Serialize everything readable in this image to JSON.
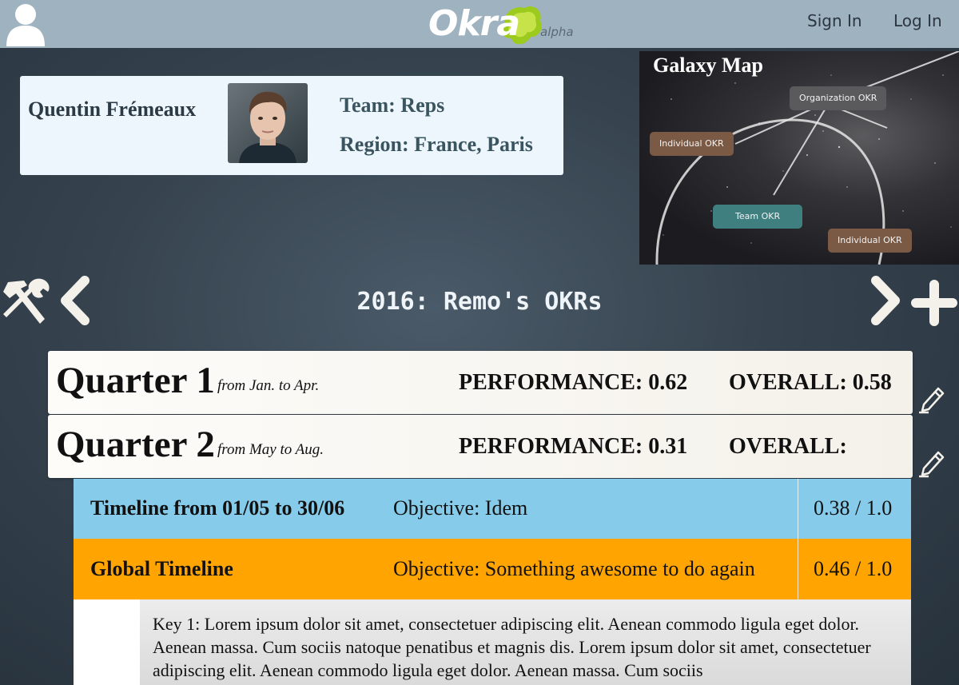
{
  "topbar": {
    "logo_text": "Okra",
    "logo_tag": "alpha",
    "sign_in": "Sign In",
    "log_in": "Log In"
  },
  "profile": {
    "name": "Quentin Frémeaux",
    "team": "Team: Reps",
    "region": "Region: France, Paris"
  },
  "galaxy": {
    "title": "Galaxy Map",
    "nodes": [
      {
        "label": "Organization OKR",
        "color": "#5a5a5c"
      },
      {
        "label": "Individual OKR",
        "color": "#7a5a44"
      },
      {
        "label": "Team OKR",
        "color": "#3f7f80"
      },
      {
        "label": "Individual OKR",
        "color": "#7a5a44"
      }
    ]
  },
  "page": {
    "title": "2016: Remo's OKRs"
  },
  "quarters": [
    {
      "name": "Quarter 1",
      "range": "from Jan. to Apr.",
      "performance": "PERFORMANCE: 0.62",
      "overall": "OVERALL: 0.58"
    },
    {
      "name": "Quarter 2",
      "range": "from May to Aug.",
      "performance": "PERFORMANCE: 0.31",
      "overall": "OVERALL:"
    }
  ],
  "timelines": [
    {
      "name": "Timeline from 01/05 to 30/06",
      "objective": "Objective: Idem",
      "score": "0.38 / 1.0",
      "color": "#86cbea"
    },
    {
      "name": "Global Timeline",
      "objective": "Objective: Something awesome to do again",
      "score": "0.46 / 1.0",
      "color": "#ffa400"
    }
  ],
  "key_result": {
    "text": "Key 1: Lorem ipsum dolor sit amet, consectetuer adipiscing elit. Aenean commodo ligula eget dolor. Aenean massa. Cum sociis natoque penatibus et magnis dis. Lorem ipsum dolor sit amet, consectetuer adipiscing elit. Aenean commodo ligula eget dolor. Aenean massa. Cum sociis"
  },
  "colors": {
    "topbar": "#9fb2bf",
    "background": "#36434f",
    "profile_card": "#eef6fd"
  }
}
